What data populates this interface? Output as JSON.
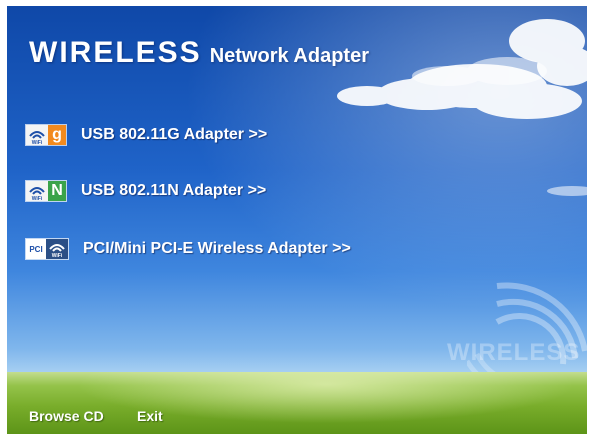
{
  "title": {
    "main": "WIRELESS",
    "sub": "Network Adapter"
  },
  "menu": [
    {
      "label": "USB 802.11G Adapter >>",
      "badge_letter": "g",
      "badge_color": "#f28a1e",
      "icon": "wifi-g-icon"
    },
    {
      "label": "USB 802.11N Adapter >>",
      "badge_letter": "N",
      "badge_color": "#3aa34a",
      "icon": "wifi-n-icon"
    },
    {
      "label": "PCI/Mini PCI-E Wireless Adapter >>",
      "badge_text": "PCI",
      "icon": "pci-wifi-icon"
    }
  ],
  "watermark": {
    "text": "WIRELESS",
    "icon": "wireless-signal-icon"
  },
  "footer": {
    "browse_cd": "Browse CD",
    "exit": "Exit"
  },
  "colors": {
    "sky_top": "#0f48a8",
    "grass": "#79ad2b",
    "text": "#ffffff"
  }
}
